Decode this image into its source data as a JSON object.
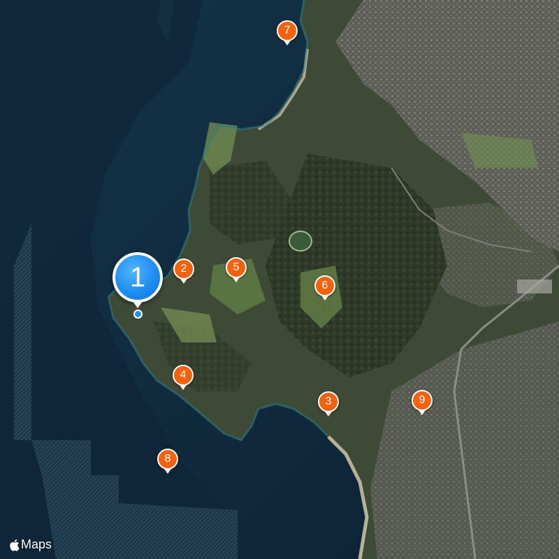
{
  "map": {
    "type": "satellite",
    "colors": {
      "ocean": "#0f2a3d",
      "land": "#3d4a36",
      "pin": "#f4620e",
      "primary_pin": "#1d8ef2"
    },
    "primary_pin": {
      "label": "1"
    },
    "pins": [
      {
        "id": "pin-2",
        "label": "2"
      },
      {
        "id": "pin-3",
        "label": "3"
      },
      {
        "id": "pin-4",
        "label": "4"
      },
      {
        "id": "pin-5",
        "label": "5"
      },
      {
        "id": "pin-6",
        "label": "6"
      },
      {
        "id": "pin-7",
        "label": "7"
      },
      {
        "id": "pin-8",
        "label": "8"
      },
      {
        "id": "pin-9",
        "label": "9"
      }
    ]
  },
  "attribution": {
    "brand": "Maps",
    "icon": "apple-logo-icon"
  }
}
